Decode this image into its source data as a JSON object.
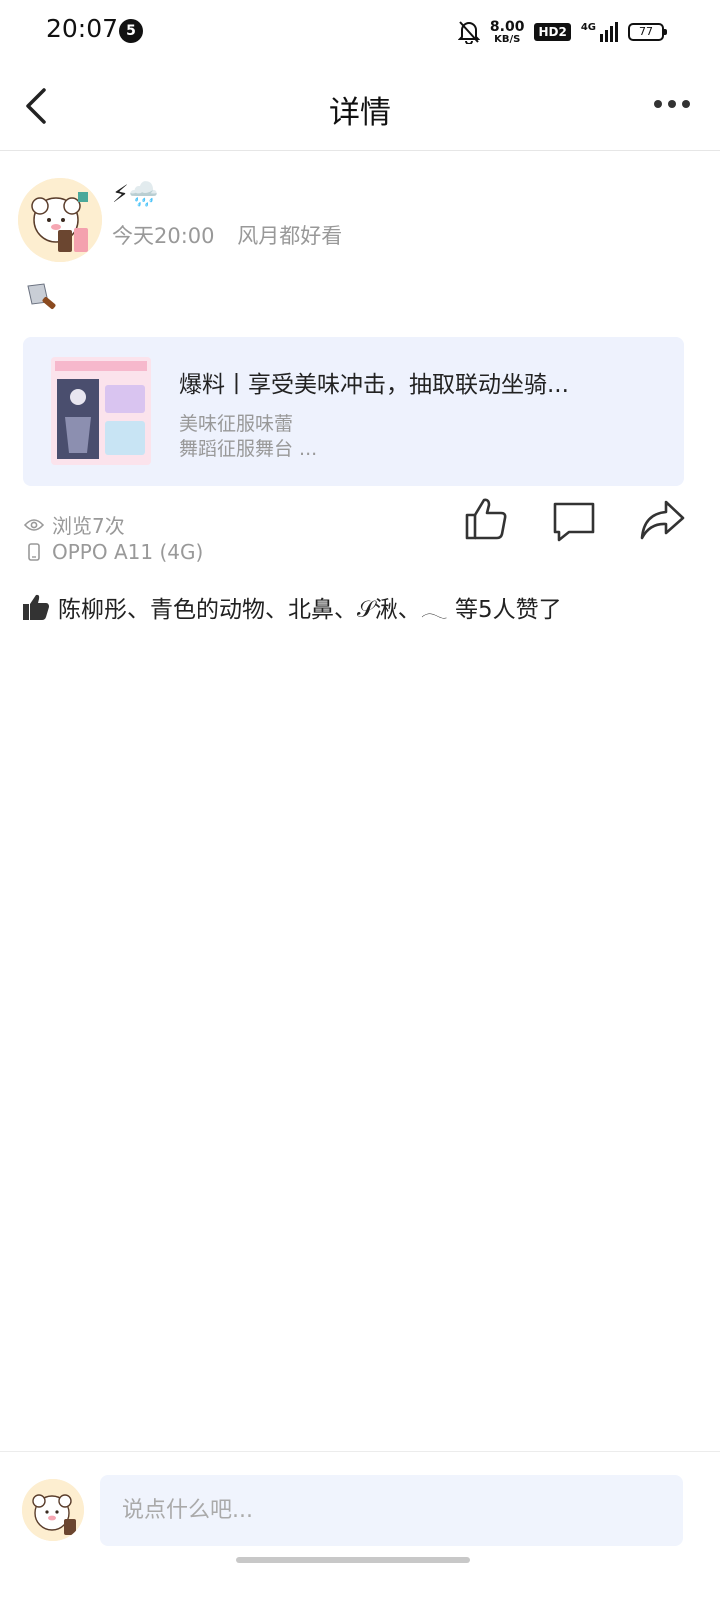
{
  "status_bar": {
    "time": "20:07",
    "notification_count": "5",
    "speed_value": "8.00",
    "speed_unit": "KB/S",
    "hd_label": "HD2",
    "network_label": "4G",
    "battery": "77"
  },
  "header": {
    "title": "详情"
  },
  "post": {
    "nickname": "⚡🌧️",
    "time": "今天20:00",
    "location": "风月都好看",
    "link_card": {
      "title": "爆料丨享受美味冲击，抽取联动坐骑...",
      "subtitle_line1": "美味征服味蕾",
      "subtitle_line2": "舞蹈征服舞台 ..."
    },
    "views": "浏览7次",
    "device": "OPPO A11 (4G)",
    "likes_text": "陈柳彤、青色的动物、北鼻、𝒮湫、𓂃 等5人赞了"
  },
  "comment_box": {
    "placeholder": "说点什么吧..."
  }
}
